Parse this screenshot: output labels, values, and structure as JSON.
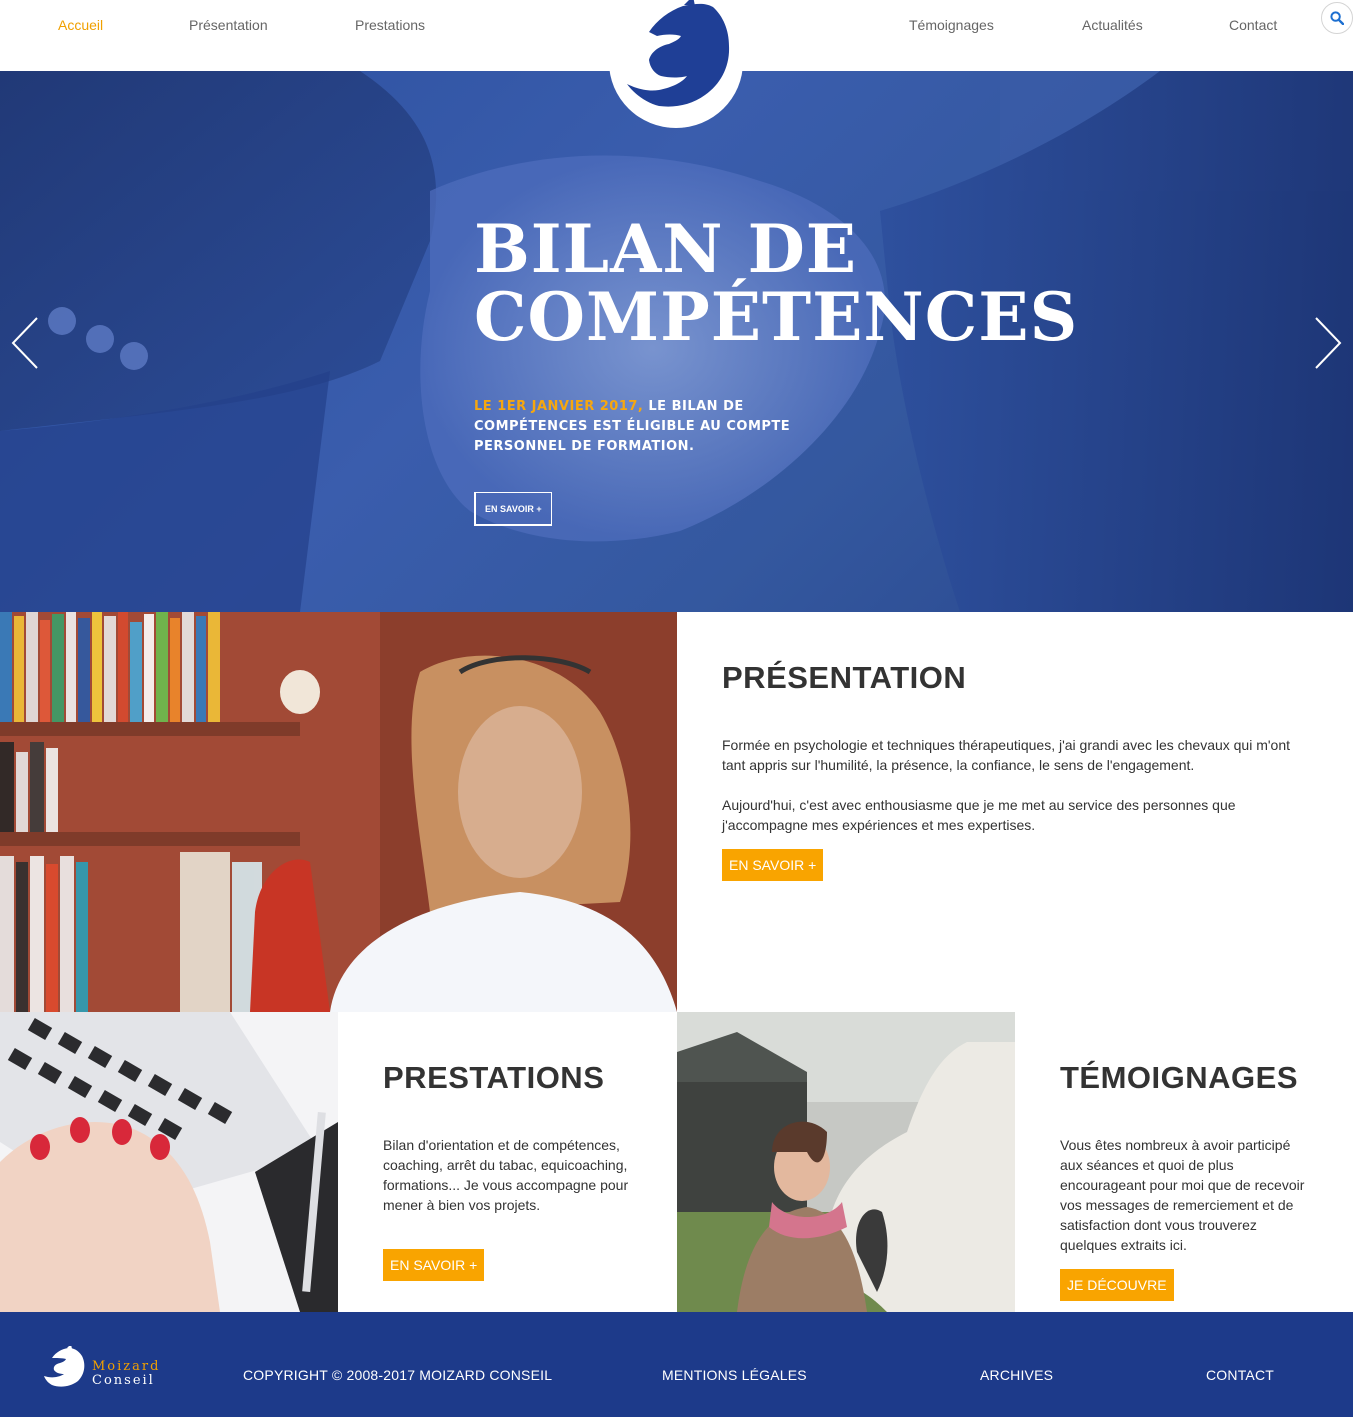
{
  "nav": {
    "items": [
      {
        "label": "Accueil",
        "active": true
      },
      {
        "label": "Présentation",
        "active": false
      },
      {
        "label": "Prestations",
        "active": false
      },
      {
        "label": "Témoignages",
        "active": false
      },
      {
        "label": "Actualités",
        "active": false
      },
      {
        "label": "Contact",
        "active": false
      }
    ],
    "logo_icon": "horse-head-logo",
    "search_icon": "search-icon"
  },
  "hero": {
    "title_line1": "BILAN DE",
    "title_line2": "COMPÉTENCES",
    "highlight": "LE 1ER JANVIER 2017,",
    "text": " LE BILAN DE COMPÉTENCES EST ÉLIGIBLE AU COMPTE PERSONNEL DE FORMATION.",
    "button": "EN SAVOIR +",
    "prev_icon": "chevron-left-icon",
    "next_icon": "chevron-right-icon"
  },
  "presentation": {
    "title": "PRÉSENTATION",
    "paragraph1": "Formée en psychologie et techniques thérapeutiques, j'ai grandi avec les chevaux qui m'ont tant appris sur l'humilité, la présence, la confiance, le sens de l'engagement.",
    "paragraph2": "Aujourd'hui, c'est avec enthousiasme que je me met au service des personnes que j'accompagne mes expériences et mes expertises.",
    "button": "EN SAVOIR +"
  },
  "prestations": {
    "title": "PRESTATIONS",
    "text": "Bilan d'orientation et de compétences, coaching, arrêt du tabac, equicoaching, formations... Je vous accompagne pour mener à bien vos projets.",
    "button": "EN SAVOIR +"
  },
  "temoignages": {
    "title": "TÉMOIGNAGES",
    "text": "Vous êtes nombreux à avoir participé aux séances et quoi de plus encourageant pour moi que de recevoir vos messages de remerciement et de satisfaction dont vous trouverez quelques extraits ici.",
    "button": "JE DÉCOUVRE"
  },
  "footer": {
    "logo_line1": "Moizard",
    "logo_line2": "Conseil",
    "copyright": "COPYRIGHT © 2008-2017 MOIZARD CONSEIL",
    "legal": "MENTIONS LÉGALES",
    "archives": "ARCHIVES",
    "contact": "CONTACT"
  },
  "colors": {
    "accent_orange": "#f9a400",
    "brand_blue": "#1d3a8a",
    "hero_blue": "#3a5dad"
  }
}
